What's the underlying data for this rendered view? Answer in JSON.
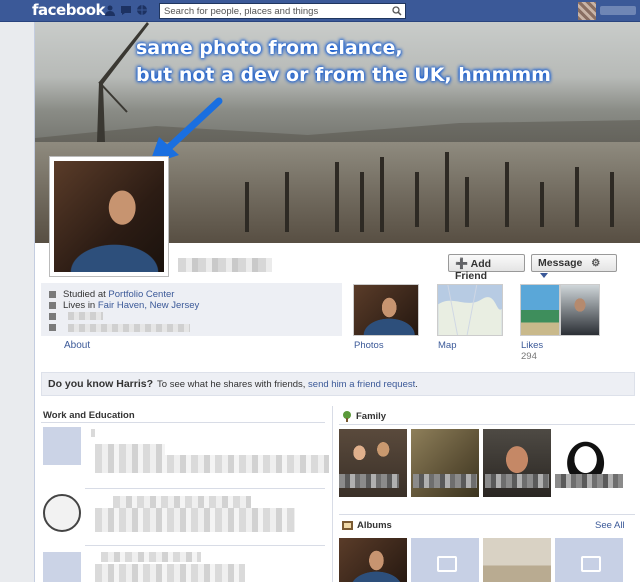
{
  "topbar": {
    "logo": "facebook",
    "search_placeholder": "Search for people, places and things"
  },
  "annotation": {
    "text": "same photo from elance,\nbut not a dev or from the UK, hmmmm"
  },
  "actions": {
    "add_friend": "Add Friend",
    "message": "Message"
  },
  "info": {
    "studied_prefix": "Studied at ",
    "studied_link": "Portfolio Center",
    "lives_prefix": "Lives in ",
    "lives_link": "Fair Haven, New Jersey",
    "about": "About"
  },
  "thumbs": {
    "photos": "Photos",
    "map": "Map",
    "likes": "Likes",
    "likes_count": "294"
  },
  "knowbox": {
    "question": "Do you know Harris?",
    "prefix": "To see what he shares with friends, ",
    "link": "send him a friend request",
    "suffix": "."
  },
  "sections": {
    "work": "Work and Education",
    "family": "Family",
    "albums": "Albums",
    "see_all": "See All"
  },
  "colors": {
    "brand": "#3b5998",
    "annotation_glow": "#1a5fd0"
  }
}
